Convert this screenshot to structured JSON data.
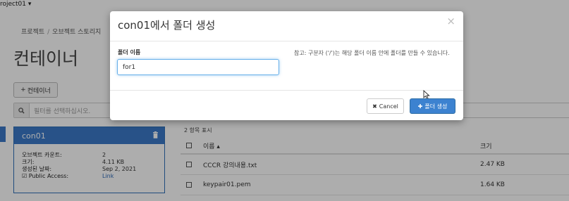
{
  "topbar": {
    "project": "roject01 ▾"
  },
  "breadcrumb": {
    "items": [
      "프로젝트",
      "오브젝트 스토리지"
    ],
    "separator": "/"
  },
  "page": {
    "title": "컨테이너"
  },
  "toolbar": {
    "add_container_label": "컨테이너",
    "filter_placeholder": "필터를 선택하십시오."
  },
  "container_card": {
    "name": "con01",
    "rows": [
      {
        "key": "오브젝트 카운트:",
        "value": "2"
      },
      {
        "key": "크기:",
        "value": "4.11 KB"
      },
      {
        "key": "생성된 날짜:",
        "value": "Sep 2, 2021"
      },
      {
        "key": "Public Access:",
        "value": "Link"
      }
    ]
  },
  "object_list": {
    "count_label": "2 항목 표시",
    "columns": {
      "name": "이름 ▴",
      "size": "크기"
    },
    "rows": [
      {
        "name": "CCCR 강의내용.txt",
        "size": "2.47 KB"
      },
      {
        "name": "keypair01.pem",
        "size": "1.64 KB"
      }
    ]
  },
  "modal": {
    "title": "con01에서 폴더 생성",
    "close_glyph": "×",
    "field_label": "폴더 이름",
    "field_value": "for1",
    "help": "참고: 구분자 ('/')는 해당 폴더 이름 안에 폴더를 만들 수 있습니다.",
    "cancel_label": "Cancel",
    "create_label": "폴더 생성"
  },
  "colors": {
    "primary": "#3c82d0",
    "card_header": "#3c7ac9",
    "link": "#2a67b5"
  }
}
